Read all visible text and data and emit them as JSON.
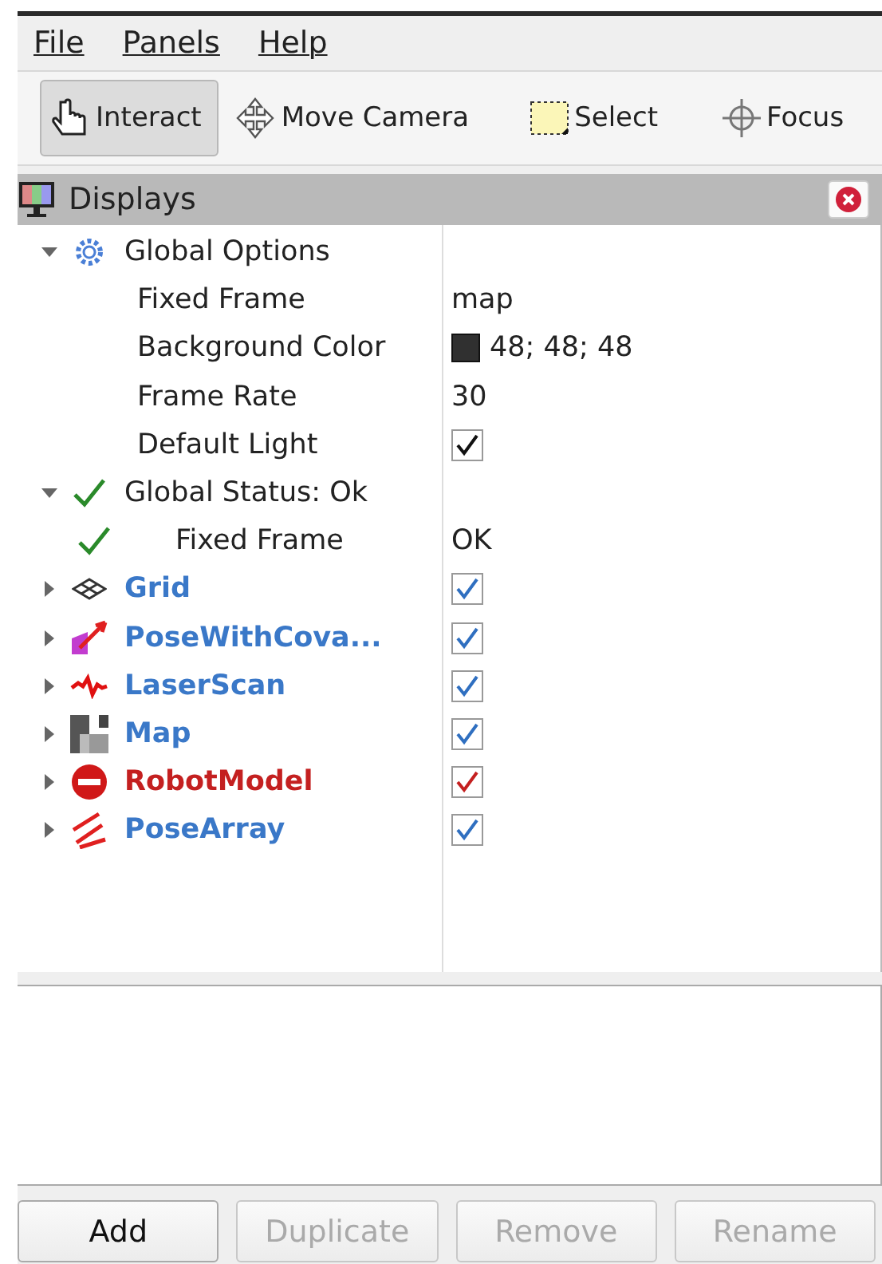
{
  "menu": [
    "File",
    "Panels",
    "Help"
  ],
  "toolbar": [
    {
      "label": "Interact",
      "kind": "interact",
      "selected": true
    },
    {
      "label": "Move Camera",
      "kind": "move",
      "selected": false
    },
    {
      "label": "Select",
      "kind": "select",
      "selected": false
    },
    {
      "label": "Focus",
      "kind": "focus",
      "selected": false
    }
  ],
  "panel": {
    "title": "Displays"
  },
  "tree": [
    {
      "label": "Global Options",
      "kind": "options",
      "expanded": true,
      "children": [
        {
          "label": "Fixed Frame",
          "kind": "text",
          "value": "map"
        },
        {
          "label": "Background Color",
          "kind": "color",
          "value": "48; 48; 48",
          "color": "#303030"
        },
        {
          "label": "Frame Rate",
          "kind": "text",
          "value": "30"
        },
        {
          "label": "Default Light",
          "kind": "checkbox",
          "checked": true
        }
      ]
    },
    {
      "label": "Global Status: Ok",
      "kind": "status",
      "expanded": true,
      "children": [
        {
          "label": "Fixed Frame",
          "kind": "status",
          "value": "OK"
        }
      ]
    },
    {
      "label": "Grid",
      "kind": "grid",
      "expanded": false,
      "checked": true,
      "error": false
    },
    {
      "label": "PoseWithCova...",
      "kind": "pose",
      "expanded": false,
      "checked": true,
      "error": false
    },
    {
      "label": "LaserScan",
      "kind": "laserscan",
      "expanded": false,
      "checked": true,
      "error": false
    },
    {
      "label": "Map",
      "kind": "map",
      "expanded": false,
      "checked": true,
      "error": false
    },
    {
      "label": "RobotModel",
      "kind": "robotmodel",
      "expanded": false,
      "checked": true,
      "error": true
    },
    {
      "label": "PoseArray",
      "kind": "posearray",
      "expanded": false,
      "checked": true,
      "error": false
    }
  ],
  "buttons": [
    {
      "label": "Add",
      "disabled": false
    },
    {
      "label": "Duplicate",
      "disabled": true
    },
    {
      "label": "Remove",
      "disabled": true
    },
    {
      "label": "Rename",
      "disabled": true
    }
  ]
}
